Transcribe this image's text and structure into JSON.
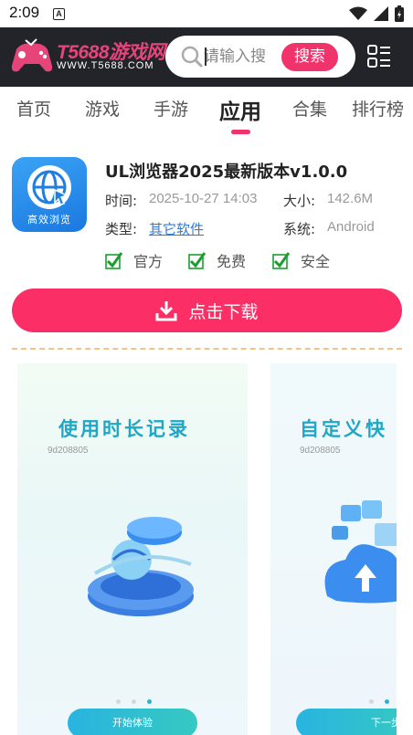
{
  "status_bar": {
    "time": "2:09",
    "notification_letter": "A"
  },
  "header": {
    "logo_main": "T5688游戏网",
    "logo_sub": "WWW.T5688.COM",
    "search_placeholder": "请输入搜",
    "search_button": "搜索"
  },
  "nav": {
    "tabs": [
      {
        "label": "首页"
      },
      {
        "label": "游戏"
      },
      {
        "label": "手游"
      },
      {
        "label": "应用"
      },
      {
        "label": "合集"
      },
      {
        "label": "排行榜"
      }
    ],
    "active_tab": "应用"
  },
  "app": {
    "icon_label": "高效浏览",
    "title": "UL浏览器2025最新版本v1.0.0",
    "time_label": "时间:",
    "time_value": "2025-10-27 14:03",
    "size_label": "大小:",
    "size_value": "142.6M",
    "type_label": "类型:",
    "type_value": "其它软件",
    "system_label": "系统:",
    "system_value": "Android",
    "badges": [
      {
        "label": "官方"
      },
      {
        "label": "免费"
      },
      {
        "label": "安全"
      }
    ]
  },
  "download": {
    "label": "点击下载"
  },
  "screenshots": [
    {
      "title": "使用时长记录",
      "code": "9d208805",
      "button": "开始体验"
    },
    {
      "title": "自定义快",
      "code": "9d208805",
      "button": "下一步"
    }
  ],
  "colors": {
    "accent": "#f0336b",
    "download": "#fb2f66",
    "header_bg": "#23242a",
    "link": "#2e7bd6",
    "check_green": "#1a9e2e"
  }
}
